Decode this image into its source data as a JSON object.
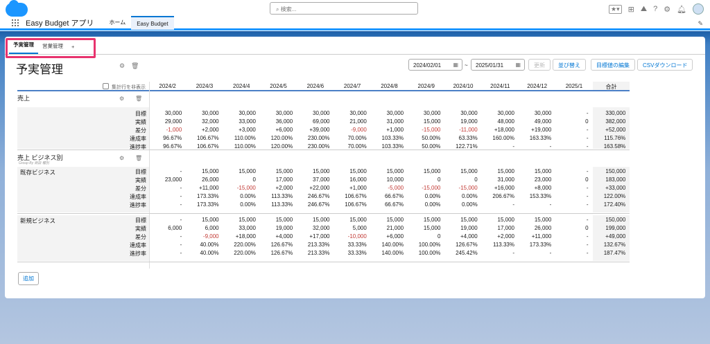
{
  "header": {
    "search_placeholder": "検索...",
    "app_name": "Easy Budget アプリ",
    "nav_tabs": [
      "ホーム",
      "Easy Budget"
    ]
  },
  "page_tabs": [
    "予実管理",
    "営業管理",
    "+"
  ],
  "page": {
    "title": "予実管理",
    "date_from": "2024/02/01",
    "date_sep": "~",
    "date_to": "2025/01/31",
    "buttons": {
      "refresh": "更新",
      "sort": "並び替え",
      "edit_target": "目標値の編集",
      "csv": "CSVダウンロード"
    },
    "hide_totals": "集計行を非表示",
    "add": "追加"
  },
  "table": {
    "months": [
      "2024/2",
      "2024/3",
      "2024/4",
      "2024/5",
      "2024/6",
      "2024/7",
      "2024/8",
      "2024/9",
      "2024/10",
      "2024/11",
      "2024/12",
      "2025/1"
    ],
    "total_header": "合計",
    "metrics": [
      "目標",
      "実績",
      "差分",
      "達成率",
      "進捗率"
    ],
    "sections": [
      {
        "title": "売上",
        "subtitle": "",
        "groups": [
          {
            "name": "",
            "rows": [
              [
                "30,000",
                "30,000",
                "30,000",
                "30,000",
                "30,000",
                "30,000",
                "30,000",
                "30,000",
                "30,000",
                "30,000",
                "30,000",
                "-",
                "330,000"
              ],
              [
                "29,000",
                "32,000",
                "33,000",
                "36,000",
                "69,000",
                "21,000",
                "31,000",
                "15,000",
                "19,000",
                "48,000",
                "49,000",
                "0",
                "382,000"
              ],
              [
                "-1,000",
                "+2,000",
                "+3,000",
                "+6,000",
                "+39,000",
                "-9,000",
                "+1,000",
                "-15,000",
                "-11,000",
                "+18,000",
                "+19,000",
                "-",
                "+52,000"
              ],
              [
                "96.67%",
                "106.67%",
                "110.00%",
                "120.00%",
                "230.00%",
                "70.00%",
                "103.33%",
                "50.00%",
                "63.33%",
                "160.00%",
                "163.33%",
                "-",
                "115.76%"
              ],
              [
                "96.67%",
                "106.67%",
                "110.00%",
                "120.00%",
                "230.00%",
                "70.00%",
                "103.33%",
                "50.00%",
                "122.71%",
                "-",
                "-",
                "-",
                "163.58%"
              ]
            ]
          }
        ]
      },
      {
        "title": "売上 ビジネス別",
        "subtitle": "Group By 商談 種別",
        "groups": [
          {
            "name": "既存ビジネス",
            "rows": [
              [
                "-",
                "15,000",
                "15,000",
                "15,000",
                "15,000",
                "15,000",
                "15,000",
                "15,000",
                "15,000",
                "15,000",
                "15,000",
                "-",
                "150,000"
              ],
              [
                "23,000",
                "26,000",
                "0",
                "17,000",
                "37,000",
                "16,000",
                "10,000",
                "0",
                "0",
                "31,000",
                "23,000",
                "0",
                "183,000"
              ],
              [
                "-",
                "+11,000",
                "-15,000",
                "+2,000",
                "+22,000",
                "+1,000",
                "-5,000",
                "-15,000",
                "-15,000",
                "+16,000",
                "+8,000",
                "-",
                "+33,000"
              ],
              [
                "-",
                "173.33%",
                "0.00%",
                "113.33%",
                "246.67%",
                "106.67%",
                "66.67%",
                "0.00%",
                "0.00%",
                "206.67%",
                "153.33%",
                "-",
                "122.00%"
              ],
              [
                "-",
                "173.33%",
                "0.00%",
                "113.33%",
                "246.67%",
                "106.67%",
                "66.67%",
                "0.00%",
                "0.00%",
                "-",
                "-",
                "-",
                "172.40%"
              ]
            ]
          },
          {
            "name": "新規ビジネス",
            "rows": [
              [
                "-",
                "15,000",
                "15,000",
                "15,000",
                "15,000",
                "15,000",
                "15,000",
                "15,000",
                "15,000",
                "15,000",
                "15,000",
                "-",
                "150,000"
              ],
              [
                "6,000",
                "6,000",
                "33,000",
                "19,000",
                "32,000",
                "5,000",
                "21,000",
                "15,000",
                "19,000",
                "17,000",
                "26,000",
                "0",
                "199,000"
              ],
              [
                "-",
                "-9,000",
                "+18,000",
                "+4,000",
                "+17,000",
                "-10,000",
                "+6,000",
                "0",
                "+4,000",
                "+2,000",
                "+11,000",
                "-",
                "+49,000"
              ],
              [
                "-",
                "40.00%",
                "220.00%",
                "126.67%",
                "213.33%",
                "33.33%",
                "140.00%",
                "100.00%",
                "126.67%",
                "113.33%",
                "173.33%",
                "-",
                "132.67%"
              ],
              [
                "-",
                "40.00%",
                "220.00%",
                "126.67%",
                "213.33%",
                "33.33%",
                "140.00%",
                "100.00%",
                "245.42%",
                "-",
                "-",
                "-",
                "187.47%"
              ]
            ]
          }
        ]
      }
    ]
  },
  "colors": {
    "negative": "#c23934",
    "accent": "#0176d3",
    "highlight": "#e8336e"
  }
}
